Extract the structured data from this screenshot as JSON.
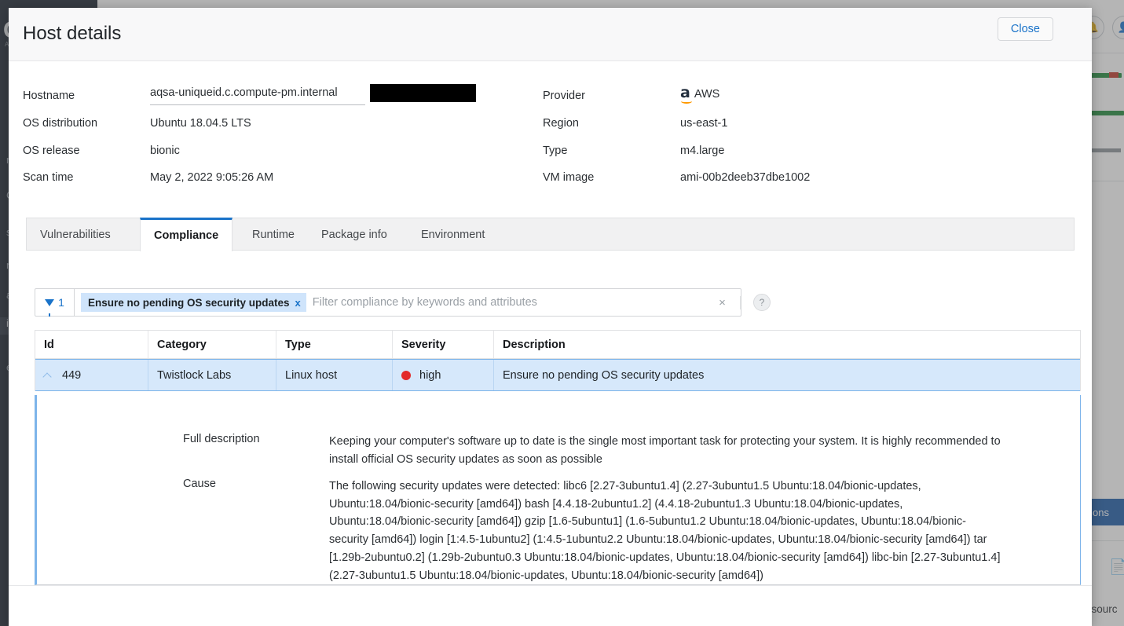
{
  "background": {
    "logo": "C",
    "logo_sub": "AL",
    "collapse_icon": "‹",
    "nav_items": [
      {
        "label": "r"
      },
      {
        "label": "Ch"
      },
      {
        "label": "s"
      },
      {
        "label": "ne"
      },
      {
        "label": "a"
      },
      {
        "label": "ia"
      },
      {
        "label": "e"
      }
    ],
    "bell_icon": "🔔",
    "user_icon": "👤",
    "actions_button": "ons",
    "export_icon": "📄",
    "resources_text": "esourc"
  },
  "modal": {
    "title": "Host details",
    "details_left": [
      {
        "label": "Hostname",
        "value": "aqsa-uniqueid.c.compute-pm.internal"
      },
      {
        "label": "OS distribution",
        "value": "Ubuntu 18.04.5 LTS"
      },
      {
        "label": "OS release",
        "value": "bionic"
      },
      {
        "label": "Scan time",
        "value": "May 2, 2022 9:05:26 AM"
      }
    ],
    "details_right": [
      {
        "label": "Provider",
        "value": "AWS"
      },
      {
        "label": "Region",
        "value": "us-east-1"
      },
      {
        "label": "Type",
        "value": "m4.large"
      },
      {
        "label": "VM image",
        "value": "ami-00b2deeb37dbe1002"
      }
    ],
    "provider_logo_letter": "a",
    "tabs": [
      {
        "label": "Vulnerabilities",
        "active": false
      },
      {
        "label": "Compliance",
        "active": true
      },
      {
        "label": "Runtime",
        "active": false
      },
      {
        "label": "Package info",
        "active": false
      },
      {
        "label": "Environment",
        "active": false
      }
    ],
    "filter": {
      "count": "1",
      "chip_label": "Ensure no pending OS security updates",
      "chip_remove": "x",
      "placeholder": "Filter compliance by keywords and attributes",
      "value": "",
      "clear_icon": "×",
      "help_icon": "?"
    },
    "table": {
      "columns": [
        "Id",
        "Category",
        "Type",
        "Severity",
        "Description"
      ],
      "rows": [
        {
          "id": "449",
          "category": "Twistlock Labs",
          "type": "Linux host",
          "severity": "high",
          "severity_color": "#e32b2b",
          "description": "Ensure no pending OS security updates",
          "expanded": true
        }
      ]
    },
    "expanded_detail": {
      "full_description_label": "Full description",
      "full_description": "Keeping your computer's software up to date is the single most important task for protecting your system. It is highly recommended to install official OS security updates as soon as possible",
      "cause_label": "Cause",
      "cause": "The following security updates were detected: libc6 [2.27-3ubuntu1.4] (2.27-3ubuntu1.5 Ubuntu:18.04/bionic-updates, Ubuntu:18.04/bionic-security [amd64]) bash [4.4.18-2ubuntu1.2] (4.4.18-2ubuntu1.3 Ubuntu:18.04/bionic-updates, Ubuntu:18.04/bionic-security [amd64]) gzip [1.6-5ubuntu1] (1.6-5ubuntu1.2 Ubuntu:18.04/bionic-updates, Ubuntu:18.04/bionic-security [amd64]) login [1:4.5-1ubuntu2] (1:4.5-1ubuntu2.2 Ubuntu:18.04/bionic-updates, Ubuntu:18.04/bionic-security [amd64]) tar [1.29b-2ubuntu0.2] (1.29b-2ubuntu0.3 Ubuntu:18.04/bionic-updates, Ubuntu:18.04/bionic-security [amd64]) libc-bin [2.27-3ubuntu1.4] (2.27-3ubuntu1.5 Ubuntu:18.04/bionic-updates, Ubuntu:18.04/bionic-security [amd64])"
    },
    "close_label": "Close"
  },
  "colors": {
    "accent_blue": "#1a73c9",
    "selected_row": "#d6e8fb",
    "severity_high": "#e32b2b"
  }
}
